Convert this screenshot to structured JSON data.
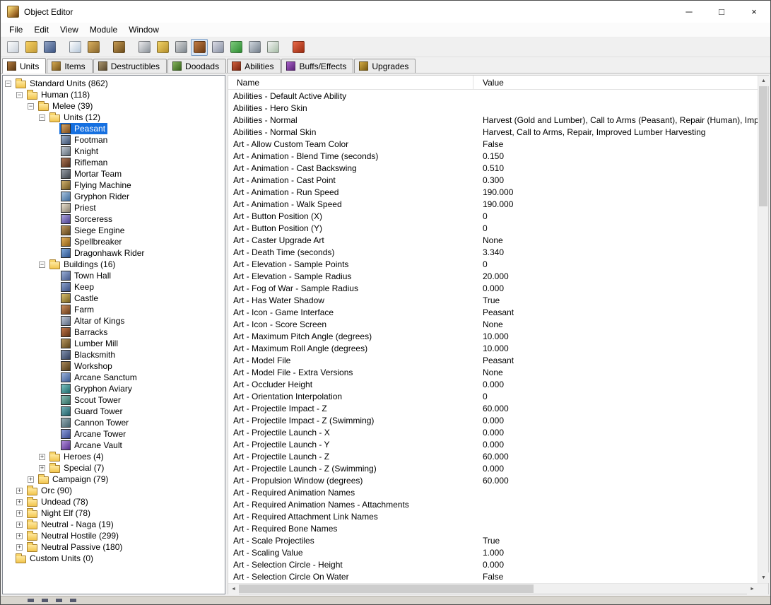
{
  "window": {
    "title": "Object Editor",
    "controls": [
      {
        "name": "minimize",
        "glyph": "─"
      },
      {
        "name": "maximize",
        "glyph": "□"
      },
      {
        "name": "close",
        "glyph": "×"
      }
    ]
  },
  "menu": {
    "items": [
      "File",
      "Edit",
      "View",
      "Module",
      "Window"
    ]
  },
  "toolbar": {
    "groups": [
      [
        {
          "name": "new-map-icon",
          "c1": "#fdfdfd",
          "c2": "#c9d1da"
        },
        {
          "name": "open-map-icon",
          "c1": "#f7d060",
          "c2": "#c49c3a"
        },
        {
          "name": "save-map-icon",
          "c1": "#93a5c6",
          "c2": "#3c5584"
        }
      ],
      [
        {
          "name": "copy-icon",
          "c1": "#ffffff",
          "c2": "#b6c7d9"
        },
        {
          "name": "paste-icon",
          "c1": "#dab160",
          "c2": "#8a672d"
        }
      ],
      [
        {
          "name": "brush-list-icon",
          "c1": "#c79c54",
          "c2": "#6d4d1d"
        }
      ],
      [
        {
          "name": "terrain-editor-icon",
          "c1": "#ebebed",
          "c2": "#8b929a"
        },
        {
          "name": "trigger-editor-icon",
          "c1": "#f2d468",
          "c2": "#b58f2c"
        },
        {
          "name": "sound-editor-icon",
          "c1": "#dadada",
          "c2": "#7c858d"
        },
        {
          "name": "object-editor-icon",
          "c1": "#c27c44",
          "c2": "#6a3a14",
          "pressed": true
        },
        {
          "name": "campaign-editor-icon",
          "c1": "#dcdce5",
          "c2": "#8790a3"
        },
        {
          "name": "ai-editor-icon",
          "c1": "#7bca7b",
          "c2": "#2d8c32"
        },
        {
          "name": "object-manager-icon",
          "c1": "#d1d8df",
          "c2": "#747f8c"
        },
        {
          "name": "import-manager-icon",
          "c1": "#f5f5f5",
          "c2": "#a5bca5"
        }
      ],
      [
        {
          "name": "test-map-icon",
          "c1": "#e96a4a",
          "c2": "#992b10"
        }
      ]
    ]
  },
  "tabs": {
    "items": [
      {
        "label": "Units",
        "icon": "units-tab-icon",
        "c1": "#b27c40",
        "c2": "#5c3812",
        "active": true
      },
      {
        "label": "Items",
        "icon": "items-tab-icon",
        "c1": "#d4a84f",
        "c2": "#78561c"
      },
      {
        "label": "Destructibles",
        "icon": "destructibles-tab-icon",
        "c1": "#a9956e",
        "c2": "#5a492d"
      },
      {
        "label": "Doodads",
        "icon": "doodads-tab-icon",
        "c1": "#80af59",
        "c2": "#37641b"
      },
      {
        "label": "Abilities",
        "icon": "abilities-tab-icon",
        "c1": "#d0603d",
        "c2": "#7a230f"
      },
      {
        "label": "Buffs/Effects",
        "icon": "buffs-tab-icon",
        "c1": "#a860ca",
        "c2": "#5a2277"
      },
      {
        "label": "Upgrades",
        "icon": "upgrades-tab-icon",
        "c1": "#d3ab43",
        "c2": "#795a11"
      }
    ]
  },
  "tree": {
    "items": [
      {
        "label": "Standard Units (862)",
        "depth": 0,
        "kind": "folder",
        "exp": "minus"
      },
      {
        "label": "Human (118)",
        "depth": 1,
        "kind": "folder",
        "exp": "minus"
      },
      {
        "label": "Melee (39)",
        "depth": 2,
        "kind": "folder",
        "exp": "minus"
      },
      {
        "label": "Units (12)",
        "depth": 3,
        "kind": "folder",
        "exp": "minus"
      },
      {
        "label": "Peasant",
        "depth": 4,
        "kind": "unit",
        "c1": "#d8a86a",
        "c2": "#7a4a1a",
        "selected": true
      },
      {
        "label": "Footman",
        "depth": 4,
        "kind": "unit",
        "c1": "#9fb4cf",
        "c2": "#3c4f6e"
      },
      {
        "label": "Knight",
        "depth": 4,
        "kind": "unit",
        "c1": "#c3ccd6",
        "c2": "#5d6874"
      },
      {
        "label": "Rifleman",
        "depth": 4,
        "kind": "unit",
        "c1": "#b07a5a",
        "c2": "#4e2a18"
      },
      {
        "label": "Mortar Team",
        "depth": 4,
        "kind": "unit",
        "c1": "#9aa0a8",
        "c2": "#3e444c"
      },
      {
        "label": "Flying Machine",
        "depth": 4,
        "kind": "unit",
        "c1": "#d2b470",
        "c2": "#6e5520"
      },
      {
        "label": "Gryphon Rider",
        "depth": 4,
        "kind": "unit",
        "c1": "#a8c4e0",
        "c2": "#3e6a9a"
      },
      {
        "label": "Priest",
        "depth": 4,
        "kind": "unit",
        "c1": "#ece4d2",
        "c2": "#8a8070"
      },
      {
        "label": "Sorceress",
        "depth": 4,
        "kind": "unit",
        "c1": "#b0a8e0",
        "c2": "#4a3e8e"
      },
      {
        "label": "Siege Engine",
        "depth": 4,
        "kind": "unit",
        "c1": "#c09a62",
        "c2": "#5e4318"
      },
      {
        "label": "Spellbreaker",
        "depth": 4,
        "kind": "unit",
        "c1": "#e6b45e",
        "c2": "#8a5c14"
      },
      {
        "label": "Dragonhawk Rider",
        "depth": 4,
        "kind": "unit",
        "c1": "#84aede",
        "c2": "#2a4f8a"
      },
      {
        "label": "Buildings (16)",
        "depth": 3,
        "kind": "folder",
        "exp": "minus"
      },
      {
        "label": "Town Hall",
        "depth": 4,
        "kind": "unit",
        "c1": "#9cb0d8",
        "c2": "#45598a"
      },
      {
        "label": "Keep",
        "depth": 4,
        "kind": "unit",
        "c1": "#8ea4cf",
        "c2": "#3a4e80"
      },
      {
        "label": "Castle",
        "depth": 4,
        "kind": "unit",
        "c1": "#d8c070",
        "c2": "#77601e"
      },
      {
        "label": "Farm",
        "depth": 4,
        "kind": "unit",
        "c1": "#cc9060",
        "c2": "#6a3c1a"
      },
      {
        "label": "Altar of Kings",
        "depth": 4,
        "kind": "unit",
        "c1": "#c2cad8",
        "c2": "#5a6880"
      },
      {
        "label": "Barracks",
        "depth": 4,
        "kind": "unit",
        "c1": "#c47a4e",
        "c2": "#5e3014"
      },
      {
        "label": "Lumber Mill",
        "depth": 4,
        "kind": "unit",
        "c1": "#b89862",
        "c2": "#5c4418"
      },
      {
        "label": "Blacksmith",
        "depth": 4,
        "kind": "unit",
        "c1": "#8494b0",
        "c2": "#323f5c"
      },
      {
        "label": "Workshop",
        "depth": 4,
        "kind": "unit",
        "c1": "#ab8a5c",
        "c2": "#503a16"
      },
      {
        "label": "Arcane Sanctum",
        "depth": 4,
        "kind": "unit",
        "c1": "#9ab2dc",
        "c2": "#3d5c94"
      },
      {
        "label": "Gryphon Aviary",
        "depth": 4,
        "kind": "unit",
        "c1": "#7ec4c4",
        "c2": "#1e6a6a"
      },
      {
        "label": "Scout Tower",
        "depth": 4,
        "kind": "unit",
        "c1": "#8cc0b8",
        "c2": "#2e6a60"
      },
      {
        "label": "Guard Tower",
        "depth": 4,
        "kind": "unit",
        "c1": "#74b2b8",
        "c2": "#1e5c64"
      },
      {
        "label": "Cannon Tower",
        "depth": 4,
        "kind": "unit",
        "c1": "#9ab0b8",
        "c2": "#42606a"
      },
      {
        "label": "Arcane Tower",
        "depth": 4,
        "kind": "unit",
        "c1": "#90a0dc",
        "c2": "#38488e"
      },
      {
        "label": "Arcane Vault",
        "depth": 4,
        "kind": "unit",
        "c1": "#b490dc",
        "c2": "#58308e"
      },
      {
        "label": "Heroes (4)",
        "depth": 3,
        "kind": "folder",
        "exp": "plus"
      },
      {
        "label": "Special (7)",
        "depth": 3,
        "kind": "folder",
        "exp": "plus"
      },
      {
        "label": "Campaign (79)",
        "depth": 2,
        "kind": "folder",
        "exp": "plus"
      },
      {
        "label": "Orc (90)",
        "depth": 1,
        "kind": "folder",
        "exp": "plus"
      },
      {
        "label": "Undead (78)",
        "depth": 1,
        "kind": "folder",
        "exp": "plus"
      },
      {
        "label": "Night Elf (78)",
        "depth": 1,
        "kind": "folder",
        "exp": "plus"
      },
      {
        "label": "Neutral - Naga (19)",
        "depth": 1,
        "kind": "folder",
        "exp": "plus"
      },
      {
        "label": "Neutral Hostile (299)",
        "depth": 1,
        "kind": "folder",
        "exp": "plus"
      },
      {
        "label": "Neutral Passive (180)",
        "depth": 1,
        "kind": "folder",
        "exp": "plus"
      },
      {
        "label": "Custom Units (0)",
        "depth": 0,
        "kind": "folder",
        "exp": "none"
      }
    ]
  },
  "table": {
    "columns": [
      "Name",
      "Value"
    ],
    "rows": [
      {
        "name": "Abilities - Default Active Ability",
        "value": ""
      },
      {
        "name": "Abilities - Hero Skin",
        "value": ""
      },
      {
        "name": "Abilities - Normal",
        "value": "Harvest (Gold and Lumber), Call to Arms (Peasant), Repair (Human), Improved L..."
      },
      {
        "name": "Abilities - Normal Skin",
        "value": "Harvest, Call to Arms, Repair, Improved Lumber Harvesting"
      },
      {
        "name": "Art - Allow Custom Team Color",
        "value": "False"
      },
      {
        "name": "Art - Animation - Blend Time (seconds)",
        "value": "0.150"
      },
      {
        "name": "Art - Animation - Cast Backswing",
        "value": "0.510"
      },
      {
        "name": "Art - Animation - Cast Point",
        "value": "0.300"
      },
      {
        "name": "Art - Animation - Run Speed",
        "value": "190.000"
      },
      {
        "name": "Art - Animation - Walk Speed",
        "value": "190.000"
      },
      {
        "name": "Art - Button Position (X)",
        "value": "0"
      },
      {
        "name": "Art - Button Position (Y)",
        "value": "0"
      },
      {
        "name": "Art - Caster Upgrade Art",
        "value": "None"
      },
      {
        "name": "Art - Death Time (seconds)",
        "value": "3.340"
      },
      {
        "name": "Art - Elevation - Sample Points",
        "value": "0"
      },
      {
        "name": "Art - Elevation - Sample Radius",
        "value": "20.000"
      },
      {
        "name": "Art - Fog of War - Sample Radius",
        "value": "0.000"
      },
      {
        "name": "Art - Has Water Shadow",
        "value": "True"
      },
      {
        "name": "Art - Icon - Game Interface",
        "value": "Peasant"
      },
      {
        "name": "Art - Icon - Score Screen",
        "value": "None"
      },
      {
        "name": "Art - Maximum Pitch Angle (degrees)",
        "value": "10.000"
      },
      {
        "name": "Art - Maximum Roll Angle (degrees)",
        "value": "10.000"
      },
      {
        "name": "Art - Model File",
        "value": "Peasant"
      },
      {
        "name": "Art - Model File - Extra Versions",
        "value": "None"
      },
      {
        "name": "Art - Occluder Height",
        "value": "0.000"
      },
      {
        "name": "Art - Orientation Interpolation",
        "value": "0"
      },
      {
        "name": "Art - Projectile Impact - Z",
        "value": "60.000"
      },
      {
        "name": "Art - Projectile Impact - Z (Swimming)",
        "value": "0.000"
      },
      {
        "name": "Art - Projectile Launch - X",
        "value": "0.000"
      },
      {
        "name": "Art - Projectile Launch - Y",
        "value": "0.000"
      },
      {
        "name": "Art - Projectile Launch - Z",
        "value": "60.000"
      },
      {
        "name": "Art - Projectile Launch - Z (Swimming)",
        "value": "0.000"
      },
      {
        "name": "Art - Propulsion Window (degrees)",
        "value": "60.000"
      },
      {
        "name": "Art - Required Animation Names",
        "value": ""
      },
      {
        "name": "Art - Required Animation Names - Attachments",
        "value": ""
      },
      {
        "name": "Art - Required Attachment Link Names",
        "value": ""
      },
      {
        "name": "Art - Required Bone Names",
        "value": ""
      },
      {
        "name": "Art - Scale Projectiles",
        "value": "True"
      },
      {
        "name": "Art - Scaling Value",
        "value": "1.000"
      },
      {
        "name": "Art - Selection Circle - Height",
        "value": "0.000"
      },
      {
        "name": "Art - Selection Circle On Water",
        "value": "False"
      }
    ]
  },
  "icons": {
    "scroll_up": "▲",
    "scroll_down": "▼",
    "scroll_left": "◄",
    "scroll_right": "►",
    "expand": "+",
    "collapse": "−"
  },
  "colors": {
    "selection": "#1670e0",
    "selection_text": "#ffffff"
  }
}
